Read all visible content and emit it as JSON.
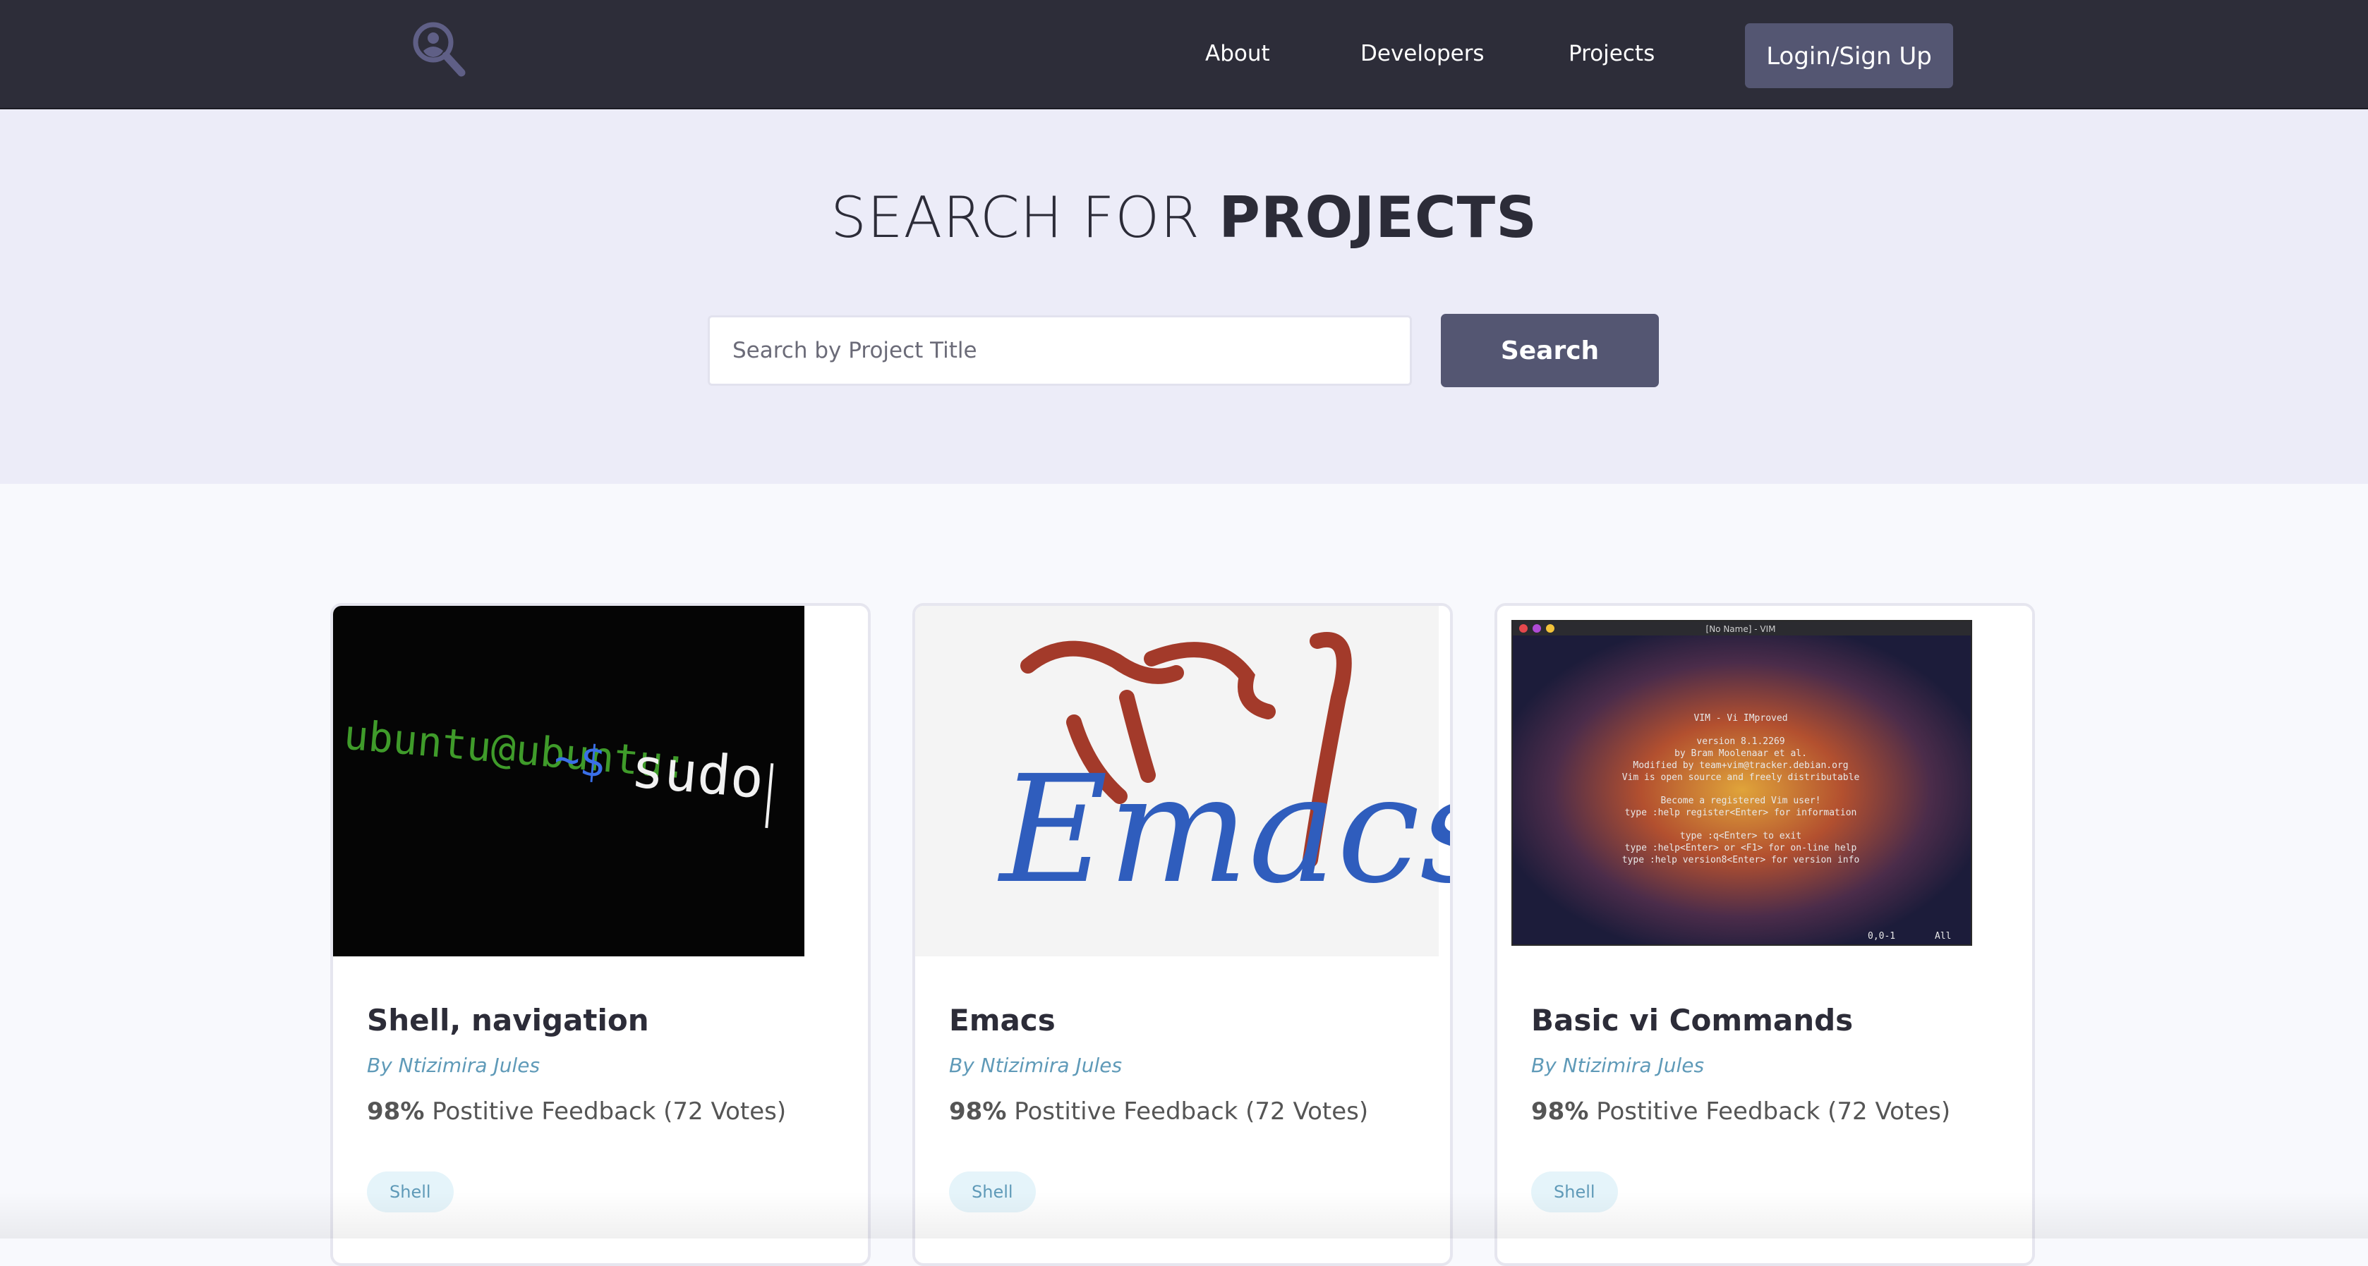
{
  "nav": {
    "links": [
      "About",
      "Developers",
      "Projects"
    ],
    "login_label": "Login/Sign Up"
  },
  "hero": {
    "title_light": "SEARCH FOR",
    "title_bold": "PROJECTS",
    "search_placeholder": "Search by Project Title",
    "search_label": "Search"
  },
  "projects": [
    {
      "title": "Shell, navigation",
      "author": "By Ntizimira Jules",
      "feedback_pct": "98%",
      "feedback_text": "Postitive Feedback (72 Votes)",
      "tag": "Shell",
      "image": {
        "prompt": "sudo",
        "user_host": "ubuntu@ubuntu:",
        "tilde": "~$"
      }
    },
    {
      "title": "Emacs",
      "author": "By Ntizimira Jules",
      "feedback_pct": "98%",
      "feedback_text": "Postitive Feedback (72 Votes)",
      "tag": "Shell",
      "image": {
        "logo_text": "Emacs"
      }
    },
    {
      "title": "Basic vi Commands",
      "author": "By Ntizimira Jules",
      "feedback_pct": "98%",
      "feedback_text": "Postitive Feedback (72 Votes)",
      "tag": "Shell",
      "image": {
        "window_title": "[No Name] - VIM",
        "lines": [
          "VIM - Vi IMproved",
          "version 8.1.2269",
          "by Bram Moolenaar et al.",
          "Modified by team+vim@tracker.debian.org",
          "Vim is open source and freely distributable",
          "Become a registered Vim user!",
          "type  :help register<Enter>   for information",
          "type  :q<Enter>               to exit",
          "type  :help<Enter>  or  <F1>  for on-line help",
          "type  :help version8<Enter>   for version info"
        ],
        "status_pos": "0,0-1",
        "status_all": "All"
      }
    }
  ],
  "colors": {
    "navbar": "#2d2d39",
    "hero_bg": "#ececf8",
    "button": "#545672",
    "author": "#5f9ab8",
    "tag_bg": "#e5f4fa"
  }
}
